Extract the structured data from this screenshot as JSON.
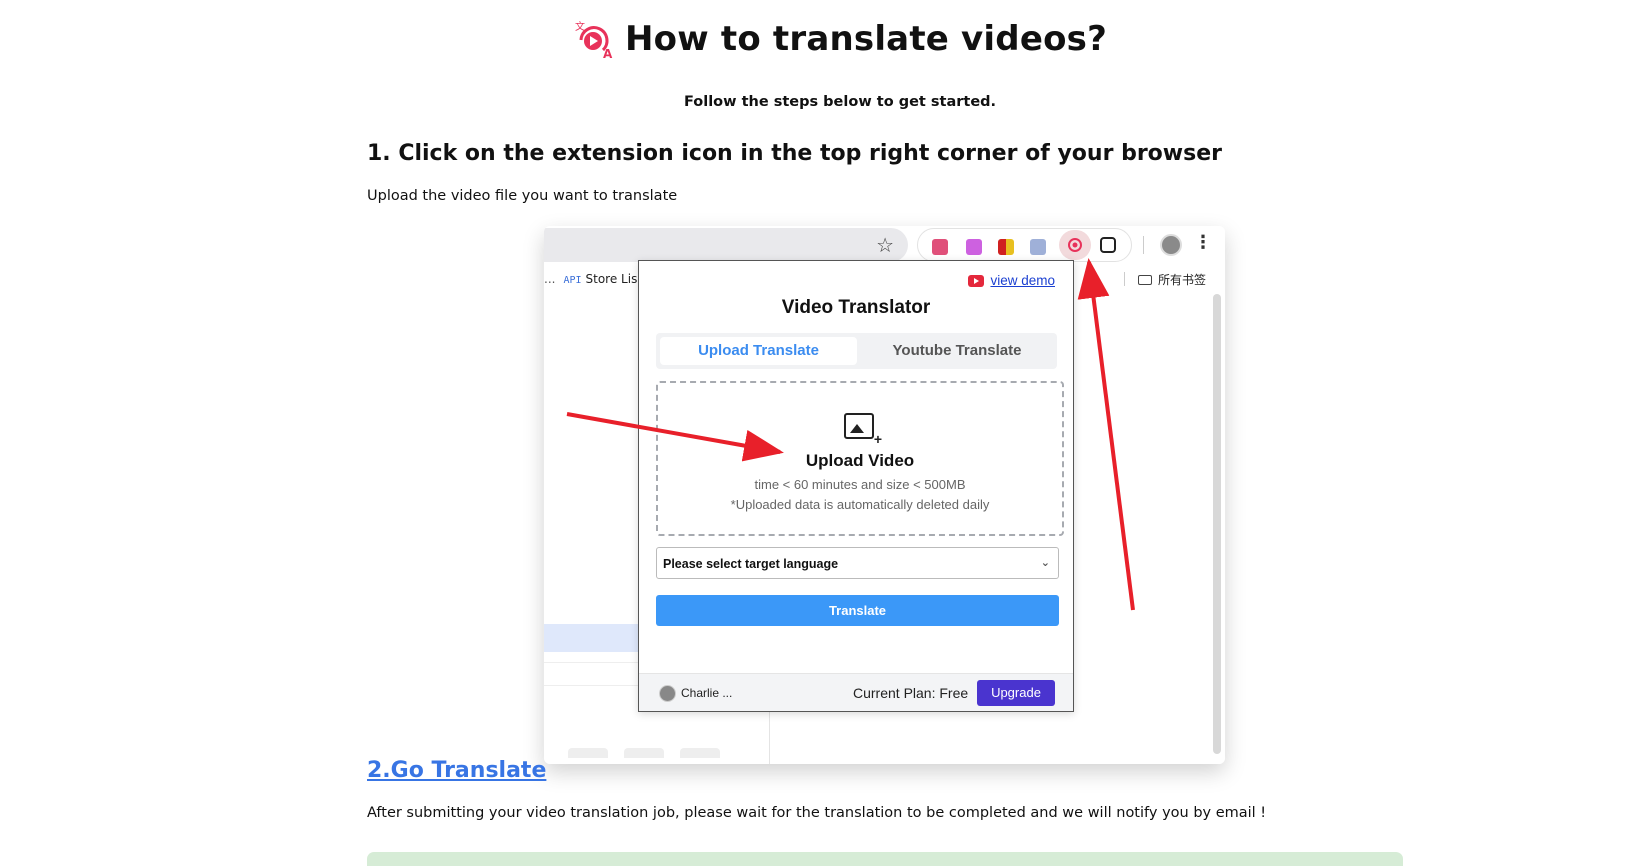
{
  "header": {
    "title": "How to translate videos?",
    "subtitle": "Follow the steps below to get started."
  },
  "step1": {
    "title": "1. Click on the extension icon in the top right corner of your browser",
    "description": "Upload the video file you want to translate"
  },
  "browser": {
    "bookmark_api_tag": "API",
    "bookmark_store": "Store Lis",
    "bookmark_overflow": "»",
    "bookmark_folder": "所有书签"
  },
  "popup": {
    "view_demo": "view demo",
    "title": "Video Translator",
    "tabs": [
      {
        "label": "Upload Translate",
        "active": true
      },
      {
        "label": "Youtube Translate",
        "active": false
      }
    ],
    "upload": {
      "title": "Upload Video",
      "line1": "time < 60 minutes and size < 500MB",
      "line2": "*Uploaded data is automatically deleted daily"
    },
    "language_select": "Please select target language",
    "translate_button": "Translate",
    "footer": {
      "user": "Charlie ...",
      "plan": "Current Plan: Free",
      "upgrade": "Upgrade"
    }
  },
  "step2": {
    "link": "2.Go Translate",
    "description": "After submitting your video translation job, please wait for the translation to be completed and we will notify you by email !"
  },
  "colors": {
    "accent_blue": "#3b98f8",
    "tab_active": "#3b8cf0",
    "upgrade": "#4a34cf",
    "link": "#3875e4",
    "arrow_red": "#e8202a",
    "logo": "#e8325a"
  }
}
